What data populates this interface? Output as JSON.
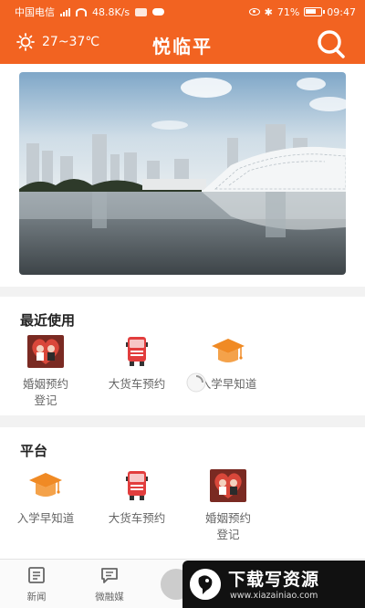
{
  "status_bar": {
    "carrier": "中国电信",
    "network_speed": "48.8K/s",
    "battery": "71%",
    "time": "09:47",
    "icons": [
      "signal-icon",
      "wifi-icon",
      "notification-icon",
      "weather-icon",
      "eye-icon",
      "bluetooth-icon",
      "battery-icon"
    ]
  },
  "header": {
    "weather": "27~37℃",
    "weather_icon": "sun-icon",
    "title": "悦临平",
    "search_icon": "search-icon",
    "background": "#f26321"
  },
  "banner": {
    "alt": "city-architecture-banner"
  },
  "recent": {
    "title": "最近使用",
    "items": [
      {
        "label": "婚姻预约登记",
        "icon": "marriage-icon"
      },
      {
        "label": "大货车预约",
        "icon": "truck-icon"
      },
      {
        "label": "入学早知道",
        "icon": "graduation-cap-icon"
      }
    ]
  },
  "platform": {
    "title": "平台",
    "items": [
      {
        "label": "入学早知道",
        "icon": "graduation-cap-icon"
      },
      {
        "label": "大货车预约",
        "icon": "truck-icon"
      },
      {
        "label": "婚姻预约登记",
        "icon": "marriage-icon"
      }
    ]
  },
  "bottom_nav": {
    "items": [
      {
        "label": "新闻",
        "icon": "news-icon"
      },
      {
        "label": "微融媒",
        "icon": "chat-icon"
      }
    ]
  },
  "watermark": {
    "main": "下载写资源",
    "url": "www.xiazainiao.com"
  },
  "colors": {
    "accent": "#f26321",
    "heart": "#d9473a",
    "truck": "#e23d3d",
    "cap": "#f08a24"
  }
}
